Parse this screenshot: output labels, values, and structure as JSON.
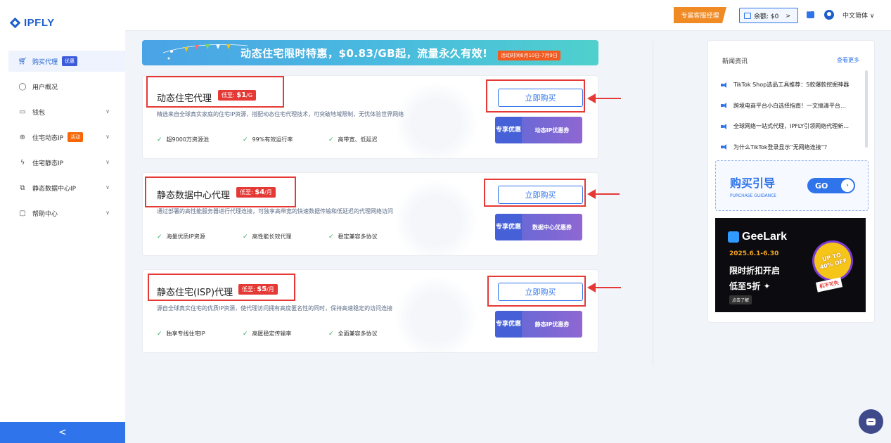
{
  "brand": {
    "name": "IPFLY"
  },
  "sidebar": {
    "items": [
      {
        "label": "购买代理",
        "badge": "优惠",
        "active": true,
        "icon": "cart-icon"
      },
      {
        "label": "用户概况",
        "icon": "user-icon"
      },
      {
        "label": "钱包",
        "icon": "wallet-icon",
        "expandable": true
      },
      {
        "label": "住宅动态IP",
        "badge": "活动",
        "icon": "globe-icon",
        "expandable": true
      },
      {
        "label": "住宅静态IP",
        "icon": "bolt-icon",
        "expandable": true
      },
      {
        "label": "静态数据中心IP",
        "icon": "datacenter-icon",
        "expandable": true
      },
      {
        "label": "帮助中心",
        "icon": "help-icon",
        "expandable": true
      }
    ],
    "collapse_label": "<"
  },
  "header": {
    "service_label": "专属客服经理",
    "balance_label": "余额: $0",
    "balance_arrow": ">",
    "language": "中文简体 ∨"
  },
  "banner": {
    "title": "动态住宅限时特惠，$0.83/GB起，流量永久有效!",
    "date": "活动时间6月10日-7月9日"
  },
  "products": [
    {
      "name": "动态住宅代理",
      "price_prefix": "低至: ",
      "price_value": "$1",
      "price_unit": "/G",
      "desc": "精选来自全球真实家庭的住宅IP资源，搭配动态住宅代理技术，可突破地域限制，无忧体验世界网络",
      "features": [
        "超9000万资源池",
        "99%有效运行率",
        "高带宽、低延迟"
      ],
      "buy_label": "立即购买",
      "coupon_left": "专享优惠",
      "coupon_right": "动态IP优惠券"
    },
    {
      "name": "静态数据中心代理",
      "price_prefix": "低至: ",
      "price_value": "$4",
      "price_unit": "/月",
      "desc": "通过部署的高性能服务器进行代理连接，可独享高带宽的快速数据传输和低延迟的代理网络访问",
      "features": [
        "海量优质IP资源",
        "高性能长效代理",
        "稳定兼容多协议"
      ],
      "buy_label": "立即购买",
      "coupon_left": "专享优惠",
      "coupon_right": "数据中心优惠券"
    },
    {
      "name": "静态住宅(ISP)代理",
      "price_prefix": "低至: ",
      "price_value": "$5",
      "price_unit": "/月",
      "desc": "源自全球真实住宅的优质IP资源，使代理访问拥有高度匿名性的同时，保持高速稳定的访问连接",
      "features": [
        "独享专线住宅IP",
        "高匿稳定传输率",
        "全面兼容多协议"
      ],
      "buy_label": "立即购买",
      "coupon_left": "专享优惠",
      "coupon_right": "静态IP优惠券"
    }
  ],
  "news": {
    "title": "新闻资讯",
    "more": "查看更多",
    "items": [
      "TikTok Shop选品工具推荐：5款爆款挖掘神器",
      "跨境电商平台小白选择指南！一文搞清平台…",
      "全球网络一站式代理，IPFLY引领网络代理新…",
      "为什么TikTok登录显示“无网络连接”？"
    ]
  },
  "guide": {
    "title": "购买引导",
    "subtitle": "PURCHASE GUIDANCE",
    "go": "GO"
  },
  "ad": {
    "brand": "GeeLark",
    "dates": "2025.6.1-6.30",
    "line1": "限时折扣开启",
    "line2": "低至5折 ✦",
    "click": "点击了解",
    "stamp1": "UP TO",
    "stamp2": "40% OFF",
    "tag": "机不可失"
  },
  "colors": {
    "accent": "#2f74ea",
    "annotation": "#e53935",
    "service": "#f08a24"
  }
}
